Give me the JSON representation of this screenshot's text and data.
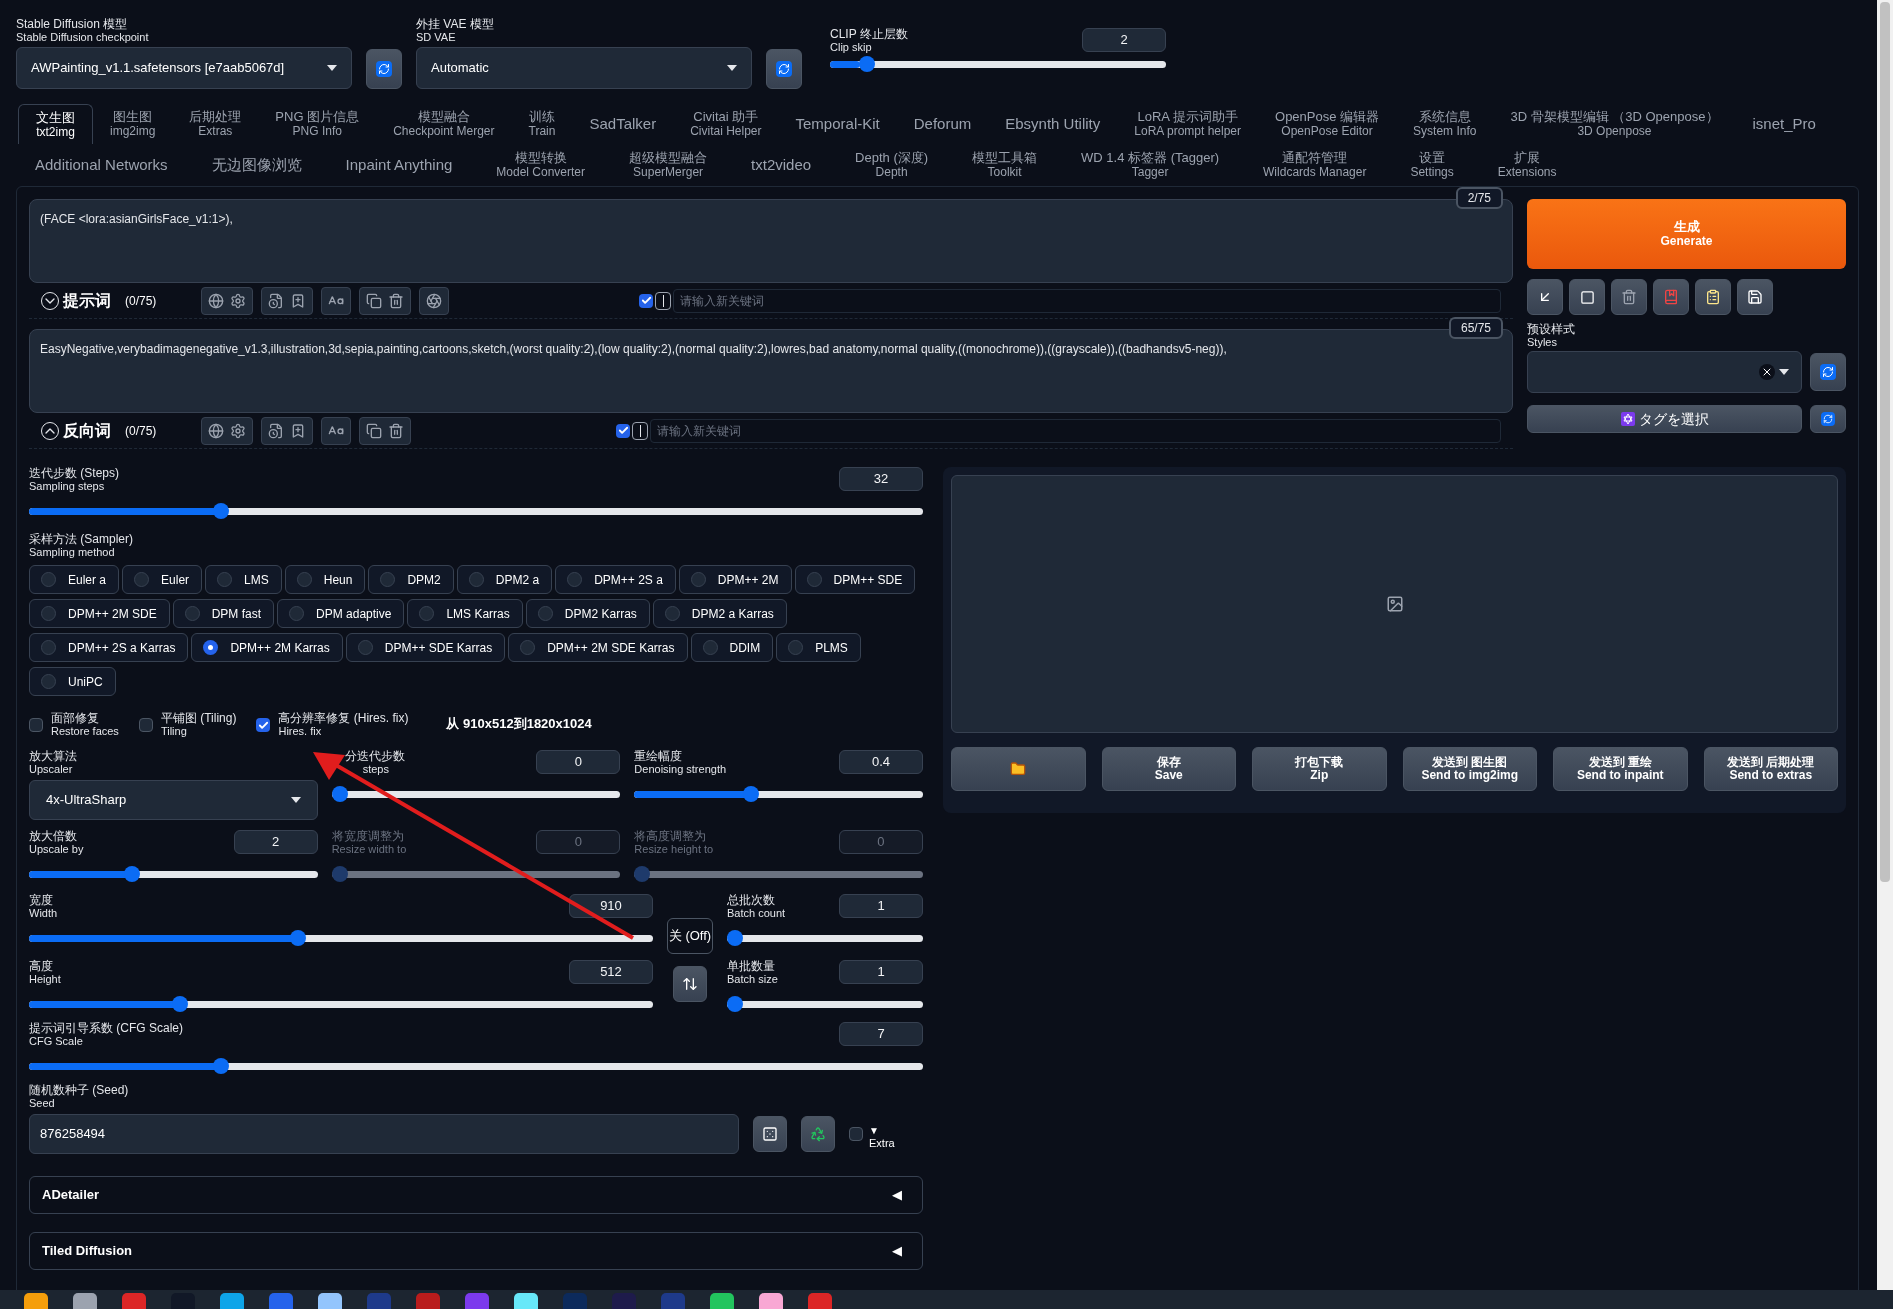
{
  "top": {
    "checkpoint": {
      "label": "Stable Diffusion 模型",
      "sublabel": "Stable Diffusion checkpoint",
      "value": "AWPainting_v1.1.safetensors [e7aab5067d]"
    },
    "vae": {
      "label": "外挂 VAE 模型",
      "sublabel": "SD VAE",
      "value": "Automatic"
    },
    "clip_skip": {
      "label": "CLIP 终止层数",
      "sublabel": "Clip skip",
      "value": "2",
      "level": 0.09
    }
  },
  "tabs": [
    {
      "label": "文生图",
      "sublabel": "txt2img",
      "selected": true
    },
    {
      "label": "图生图",
      "sublabel": "img2img",
      "selected": false
    },
    {
      "label": "后期处理",
      "sublabel": "Extras",
      "selected": false
    },
    {
      "label": "PNG 图片信息",
      "sublabel": "PNG Info",
      "selected": false
    },
    {
      "label": "模型融合",
      "sublabel": "Checkpoint Merger",
      "selected": false
    },
    {
      "label": "训练",
      "sublabel": "Train",
      "selected": false
    },
    {
      "label": "SadTalker",
      "selected": false
    },
    {
      "label": "Civitai 助手",
      "sublabel": "Civitai Helper",
      "selected": false
    },
    {
      "label": "Temporal-Kit",
      "selected": false
    },
    {
      "label": "Deforum",
      "selected": false
    },
    {
      "label": "Ebsynth Utility",
      "selected": false
    },
    {
      "label": "LoRA 提示词助手",
      "sublabel": "LoRA prompt helper",
      "selected": false
    },
    {
      "label": "OpenPose 编辑器",
      "sublabel": "OpenPose Editor",
      "selected": false
    },
    {
      "label": "系统信息",
      "sublabel": "System Info",
      "selected": false
    },
    {
      "label": "3D 骨架模型编辑 （3D Openpose）",
      "sublabel": "3D Openpose",
      "selected": false
    },
    {
      "label": "isnet_Pro",
      "selected": false
    }
  ],
  "tabs_row2": [
    {
      "label": "Additional Networks",
      "selected": false
    },
    {
      "label": "无边图像浏览",
      "selected": false
    },
    {
      "label": "Inpaint Anything",
      "selected": false
    },
    {
      "label": "模型转换",
      "sublabel": "Model Converter",
      "selected": false
    },
    {
      "label": "超级模型融合",
      "sublabel": "SuperMerger",
      "selected": false
    },
    {
      "label": "txt2video",
      "selected": false
    },
    {
      "label": "Depth (深度)",
      "sublabel": "Depth",
      "selected": false
    },
    {
      "label": "模型工具箱",
      "sublabel": "Toolkit",
      "selected": false
    },
    {
      "label": "WD 1.4 标签器 (Tagger)",
      "sublabel": "Tagger",
      "selected": false
    },
    {
      "label": "通配符管理",
      "sublabel": "Wildcards Manager",
      "selected": false
    },
    {
      "label": "设置",
      "sublabel": "Settings",
      "selected": false
    },
    {
      "label": "扩展",
      "sublabel": "Extensions",
      "selected": false
    }
  ],
  "prompts": [
    {
      "text": "(FACE <lora:asianGirlsFace_v1:1>),",
      "counter": "2/75",
      "title": "提示词",
      "count": "(0/75)",
      "expanded": true,
      "extra_tool": true,
      "keyword_enabled": true,
      "keyword_placeholder": "请输入新关键词"
    },
    {
      "text": "EasyNegative,verybadimagenegative_v1.3,illustration,3d,sepia,painting,cartoons,sketch,(worst quality:2),(low quality:2),(normal quality:2),lowres,bad anatomy,normal quality,((monochrome)),((grayscale)),((badhandsv5-neg)),",
      "counter": "65/75",
      "title": "反向词",
      "count": "(0/75)",
      "expanded": false,
      "extra_tool": false,
      "keyword_enabled": true,
      "keyword_placeholder": "请输入新关键词"
    }
  ],
  "generate": {
    "label": "生成",
    "sublabel": "Generate"
  },
  "styles": {
    "label": "预设样式",
    "sublabel": "Styles"
  },
  "tag_select": "タグを選択",
  "steps": {
    "label": "迭代步数 (Steps)",
    "sublabel": "Sampling steps",
    "value": "32",
    "level": 0.21
  },
  "sampler": {
    "label": "采样方法 (Sampler)",
    "sublabel": "Sampling method",
    "options": [
      {
        "label": "Euler a",
        "selected": false
      },
      {
        "label": "Euler",
        "selected": false
      },
      {
        "label": "LMS",
        "selected": false
      },
      {
        "label": "Heun",
        "selected": false
      },
      {
        "label": "DPM2",
        "selected": false
      },
      {
        "label": "DPM2 a",
        "selected": false
      },
      {
        "label": "DPM++ 2S a",
        "selected": false
      },
      {
        "label": "DPM++ 2M",
        "selected": false
      },
      {
        "label": "DPM++ SDE",
        "selected": false
      },
      {
        "label": "DPM++ 2M SDE",
        "selected": false
      },
      {
        "label": "DPM fast",
        "selected": false
      },
      {
        "label": "DPM adaptive",
        "selected": false
      },
      {
        "label": "LMS Karras",
        "selected": false
      },
      {
        "label": "DPM2 Karras",
        "selected": false
      },
      {
        "label": "DPM2 a Karras",
        "selected": false
      },
      {
        "label": "DPM++ 2S a Karras",
        "selected": false
      },
      {
        "label": "DPM++ 2M Karras",
        "selected": true
      },
      {
        "label": "DPM++ SDE Karras",
        "selected": false
      },
      {
        "label": "DPM++ 2M SDE Karras",
        "selected": false
      },
      {
        "label": "DDIM",
        "selected": false
      },
      {
        "label": "PLMS",
        "selected": false
      },
      {
        "label": "UniPC",
        "selected": false
      }
    ]
  },
  "options": [
    {
      "label": "面部修复",
      "sublabel": "Restore faces",
      "checked": false
    },
    {
      "label": "平铺图 (Tiling)",
      "sublabel": "Tiling",
      "checked": false
    },
    {
      "label": "高分辨率修复 (Hires. fix)",
      "sublabel": "Hires. fix",
      "checked": true
    }
  ],
  "hires_note": "从 910x512到1820x1024",
  "upscaler": {
    "label": "放大算法",
    "sublabel": "Upscaler",
    "value": "4x-UltraSharp"
  },
  "hires_steps": {
    "label": "分迭代步数",
    "sublabel": "steps",
    "value": "0",
    "level": 0,
    "disabled": false
  },
  "denoising": {
    "label": "重绘幅度",
    "sublabel": "Denoising strength",
    "value": "0.4",
    "level": 0.4,
    "disabled": false
  },
  "upscale_by": {
    "label": "放大倍数",
    "sublabel": "Upscale by",
    "value": "2",
    "level": 0.35,
    "disabled": false
  },
  "resize_width": {
    "label": "将宽度调整为",
    "sublabel": "Resize width to",
    "value": "0",
    "level": 0,
    "disabled": true
  },
  "resize_height": {
    "label": "将高度调整为",
    "sublabel": "Resize height to",
    "value": "0",
    "level": 0,
    "disabled": true
  },
  "width": {
    "label": "宽度",
    "sublabel": "Width",
    "value": "910",
    "level": 0.43,
    "disabled": false
  },
  "height": {
    "label": "高度",
    "sublabel": "Height",
    "value": "512",
    "level": 0.235,
    "disabled": false
  },
  "batch_count": {
    "label": "总批次数",
    "sublabel": "Batch count",
    "value": "1",
    "level": 0,
    "disabled": false
  },
  "batch_size": {
    "label": "单批数量",
    "sublabel": "Batch size",
    "value": "1",
    "level": 0,
    "disabled": false
  },
  "aspect_toggle": "关 (Off)",
  "cfg": {
    "label": "提示词引导系数 (CFG Scale)",
    "sublabel": "CFG Scale",
    "value": "7",
    "level": 0.21,
    "disabled": false
  },
  "seed": {
    "label": "随机数种子 (Seed)",
    "sublabel": "Seed",
    "value": "876258494",
    "extra_checked": false,
    "extra_arrow": "▼",
    "extra_label": "Extra"
  },
  "accordions": [
    {
      "title": "ADetailer",
      "arrow": "◀"
    },
    {
      "title": "Tiled Diffusion",
      "arrow": "◀"
    }
  ],
  "gallery_buttons": [
    {
      "kind": "folder"
    },
    {
      "kind": "text",
      "label": "保存",
      "sublabel": "Save"
    },
    {
      "kind": "text",
      "label": "打包下载",
      "sublabel": "Zip"
    },
    {
      "kind": "text",
      "label": "发送到 图生图",
      "sublabel": "Send to img2img"
    },
    {
      "kind": "text",
      "label": "发送到 重绘",
      "sublabel": "Send to inpaint"
    },
    {
      "kind": "text",
      "label": "发送到 后期处理",
      "sublabel": "Send to extras"
    }
  ]
}
